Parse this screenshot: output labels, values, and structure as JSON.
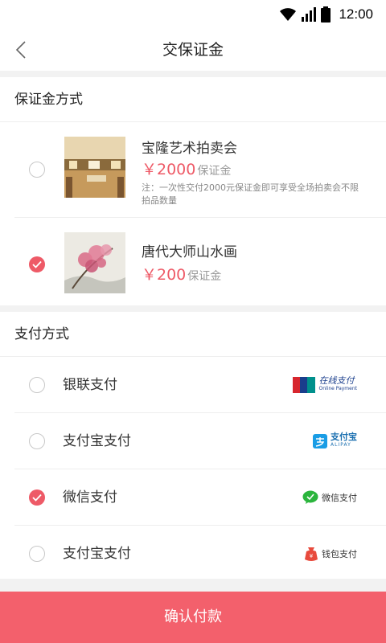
{
  "status": {
    "time": "12:00"
  },
  "header": {
    "title": "交保证金",
    "back_icon": "chevron-left-icon"
  },
  "deposit": {
    "section_title": "保证金方式",
    "items": [
      {
        "name": "宝隆艺术拍卖会",
        "price": "￥2000",
        "unit": "保证金",
        "note": "注：一次性交付2000元保证金即可享受全场拍卖会不限拍品数量",
        "selected": false
      },
      {
        "name": "唐代大师山水画",
        "price": "￥200",
        "unit": "保证金",
        "note": "",
        "selected": true
      }
    ]
  },
  "payment": {
    "section_title": "支付方式",
    "methods": [
      {
        "label": "银联支付",
        "logo_text": "在线支付",
        "logo_sub": "Online Payment",
        "selected": false
      },
      {
        "label": "支付宝支付",
        "logo_text": "支付宝",
        "logo_sub": "ALIPAY",
        "selected": false
      },
      {
        "label": "微信支付",
        "logo_text": "微信支付",
        "selected": true
      },
      {
        "label": "支付宝支付",
        "logo_text": "钱包支付",
        "selected": false
      }
    ]
  },
  "footer": {
    "confirm_label": "确认付款"
  },
  "colors": {
    "accent": "#ee5a67",
    "button": "#f3606c"
  }
}
